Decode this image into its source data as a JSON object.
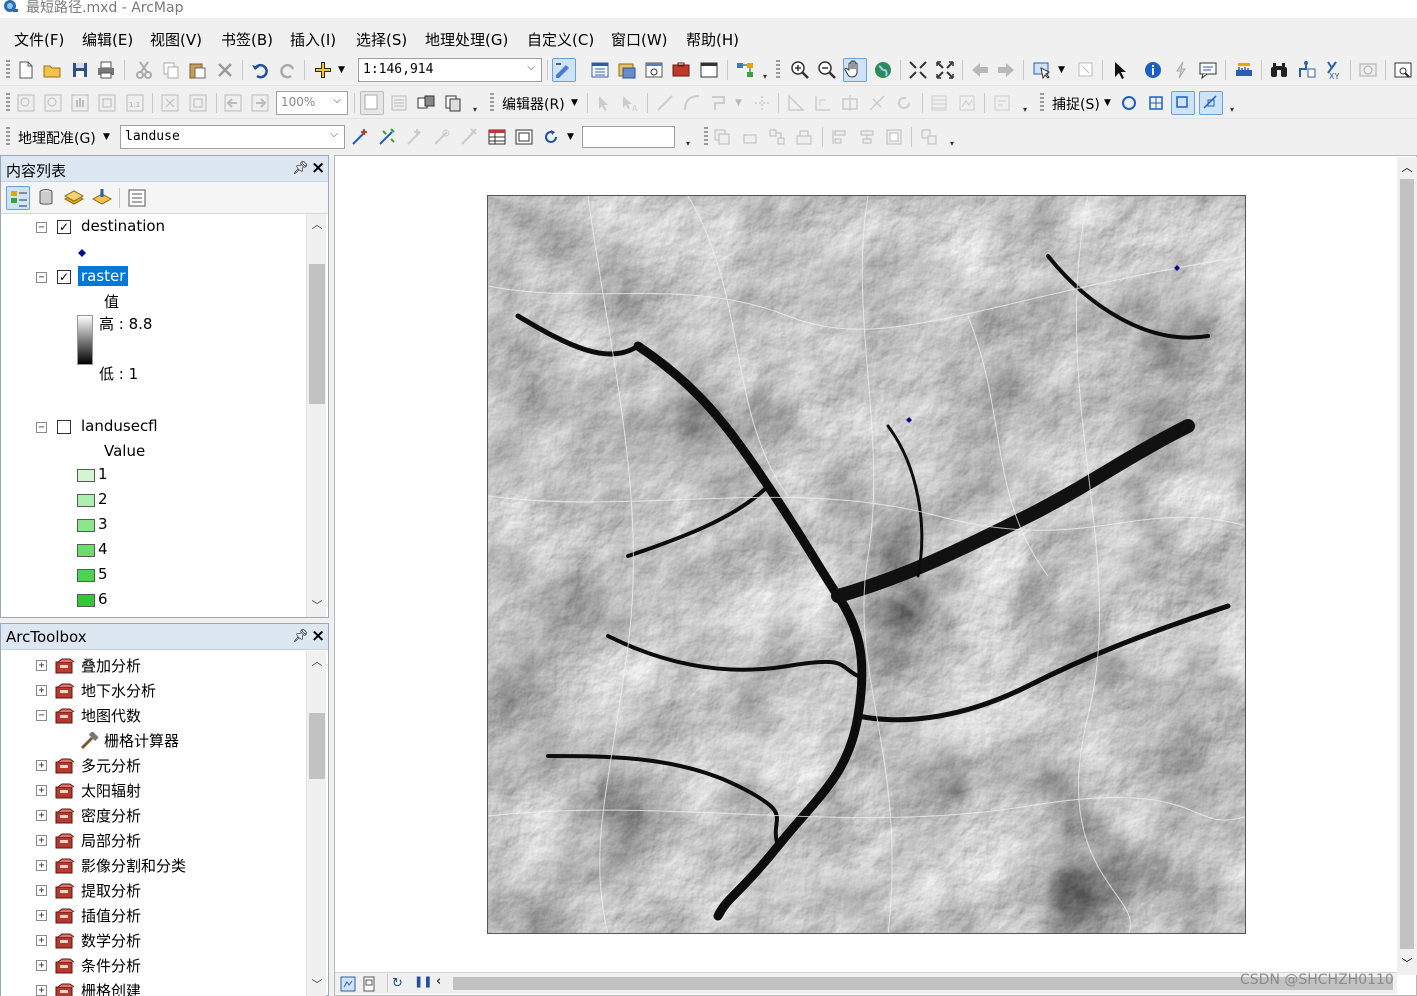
{
  "window": {
    "title": "最短路径.mxd - ArcMap"
  },
  "menu": [
    "文件(F)",
    "编辑(E)",
    "视图(V)",
    "书签(B)",
    "插入(I)",
    "选择(S)",
    "地理处理(G)",
    "自定义(C)",
    "窗口(W)",
    "帮助(H)"
  ],
  "standard_toolbar": {
    "scale": "1:146,914"
  },
  "tools_toolbar": {
    "zoom": "100%",
    "editor_label": "编辑器(R)",
    "snapping_label": "捕捉(S)"
  },
  "georef_toolbar": {
    "label": "地理配准(G)",
    "layer": "landuse",
    "rotate_value": ""
  },
  "toc": {
    "title": "内容列表",
    "layers": [
      {
        "name": "destination",
        "checked": true
      },
      {
        "name": "raster",
        "checked": true,
        "selected": true,
        "legend_title": "值",
        "high": "高 : 8.8",
        "low": "低 : 1"
      },
      {
        "name": "landusecfl",
        "checked": false,
        "legend_title": "Value",
        "classes": [
          {
            "label": "1",
            "color": "#d3f5d3"
          },
          {
            "label": "2",
            "color": "#aeeeae"
          },
          {
            "label": "3",
            "color": "#8ce48c"
          },
          {
            "label": "4",
            "color": "#6cdc6c"
          },
          {
            "label": "5",
            "color": "#4fd34f"
          },
          {
            "label": "6",
            "color": "#31c931"
          }
        ]
      }
    ]
  },
  "toolbox": {
    "title": "ArcToolbox",
    "items": [
      {
        "label": "叠加分析",
        "expanded": false
      },
      {
        "label": "地下水分析",
        "expanded": false
      },
      {
        "label": "地图代数",
        "expanded": true,
        "children": [
          "栅格计算器"
        ]
      },
      {
        "label": "多元分析",
        "expanded": false
      },
      {
        "label": "太阳辐射",
        "expanded": false
      },
      {
        "label": "密度分析",
        "expanded": false
      },
      {
        "label": "局部分析",
        "expanded": false
      },
      {
        "label": "影像分割和分类",
        "expanded": false
      },
      {
        "label": "提取分析",
        "expanded": false
      },
      {
        "label": "插值分析",
        "expanded": false
      },
      {
        "label": "数学分析",
        "expanded": false
      },
      {
        "label": "条件分析",
        "expanded": false
      },
      {
        "label": "栅格创建",
        "expanded": false
      }
    ]
  },
  "map": {
    "points_color": "#0a0a8c"
  },
  "watermark": "CSDN @SHCHZH0110",
  "colors": {
    "selection": "#0078d7",
    "panel_header": "#dde7f2"
  }
}
